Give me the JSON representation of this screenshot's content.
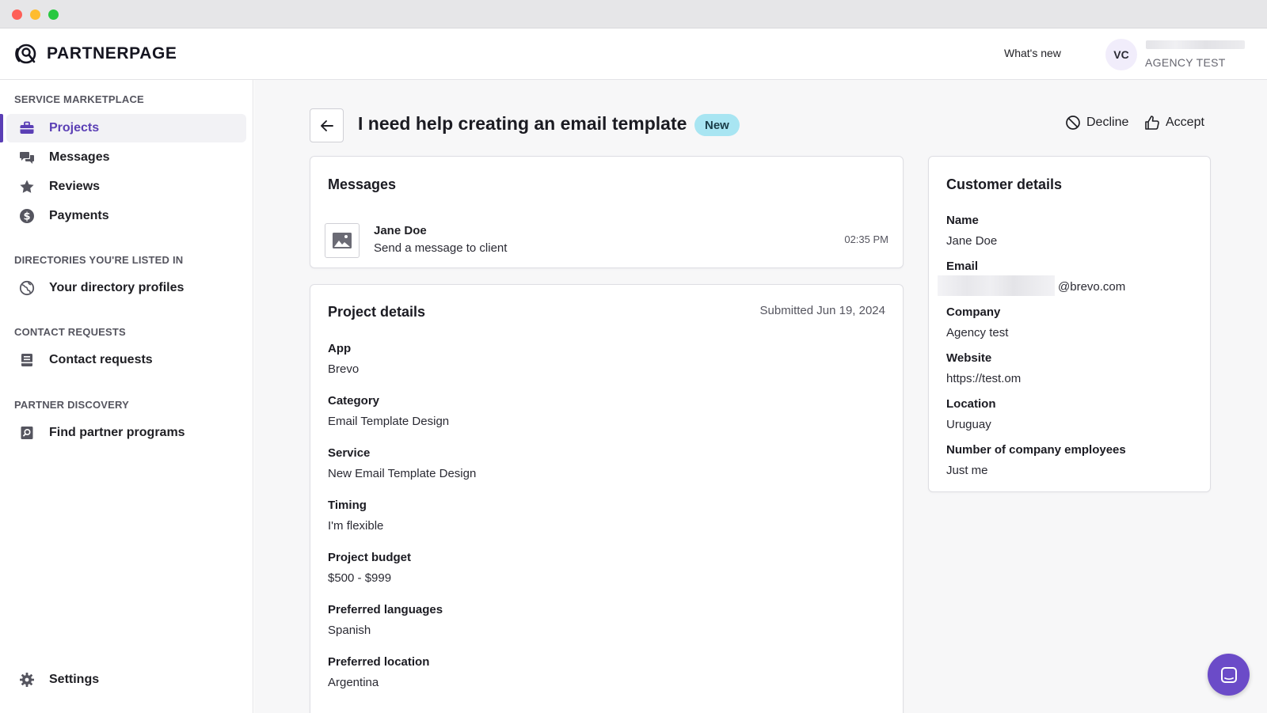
{
  "brand": {
    "name_part1": "PARTNER",
    "name_part2": "PAGE",
    "accent_color": "#5b3fb5"
  },
  "header": {
    "whats_new": "What's new",
    "avatar_initials": "VC",
    "org_name": "AGENCY TEST"
  },
  "sidebar": {
    "sections": [
      {
        "label": "SERVICE MARKETPLACE"
      },
      {
        "label": "DIRECTORIES YOU'RE LISTED IN"
      },
      {
        "label": "CONTACT REQUESTS"
      },
      {
        "label": "PARTNER DISCOVERY"
      }
    ],
    "items": [
      {
        "label": "Projects",
        "icon": "briefcase-icon",
        "active": true
      },
      {
        "label": "Messages",
        "icon": "chat-bubbles-icon"
      },
      {
        "label": "Reviews",
        "icon": "star-icon"
      },
      {
        "label": "Payments",
        "icon": "dollar-circle-icon"
      },
      {
        "label": "Your directory profiles",
        "icon": "globe-icon"
      },
      {
        "label": "Contact requests",
        "icon": "clipboard-icon"
      },
      {
        "label": "Find partner programs",
        "icon": "search-book-icon"
      },
      {
        "label": "Settings",
        "icon": "gear-icon"
      }
    ]
  },
  "page": {
    "title": "I need help creating an email template",
    "badge": "New",
    "badge_color": "#a8e5f2",
    "actions": {
      "decline": "Decline",
      "accept": "Accept"
    }
  },
  "messages_card": {
    "title": "Messages",
    "items": [
      {
        "name": "Jane Doe",
        "text": "Send a message to client",
        "time": "02:35 PM"
      }
    ]
  },
  "project_details": {
    "title": "Project details",
    "submitted": "Submitted Jun 19, 2024",
    "fields": [
      {
        "label": "App",
        "value": "Brevo"
      },
      {
        "label": "Category",
        "value": "Email Template Design"
      },
      {
        "label": "Service",
        "value": "New Email Template Design"
      },
      {
        "label": "Timing",
        "value": "I'm flexible"
      },
      {
        "label": "Project budget",
        "value": "$500 - $999"
      },
      {
        "label": "Preferred languages",
        "value": "Spanish"
      },
      {
        "label": "Preferred location",
        "value": "Argentina"
      }
    ]
  },
  "customer_details": {
    "title": "Customer details",
    "fields": [
      {
        "label": "Name",
        "value": "Jane Doe"
      },
      {
        "label": "Email",
        "value": "@brevo.com"
      },
      {
        "label": "Company",
        "value": "Agency test"
      },
      {
        "label": "Website",
        "value": "https://test.om"
      },
      {
        "label": "Location",
        "value": "Uruguay"
      },
      {
        "label": "Number of company employees",
        "value": "Just me"
      }
    ]
  }
}
